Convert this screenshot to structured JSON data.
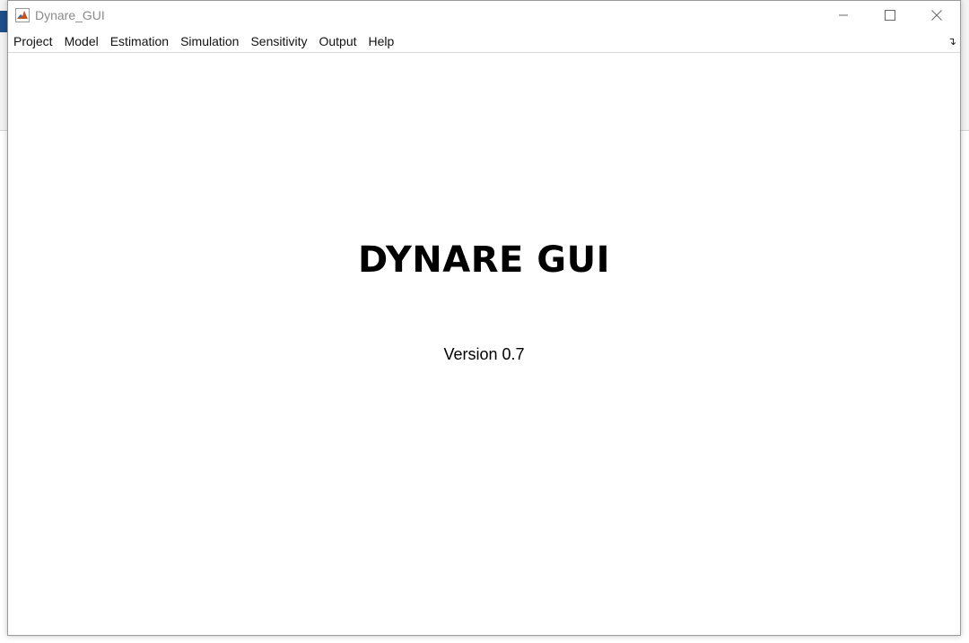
{
  "window": {
    "title": "Dynare_GUI",
    "icon": "matlab-icon"
  },
  "window_controls": {
    "minimize_icon": "minimize-icon",
    "maximize_icon": "maximize-icon",
    "close_icon": "close-icon"
  },
  "menubar": {
    "items": [
      {
        "label": "Project"
      },
      {
        "label": "Model"
      },
      {
        "label": "Estimation"
      },
      {
        "label": "Simulation"
      },
      {
        "label": "Sensitivity"
      },
      {
        "label": "Output"
      },
      {
        "label": "Help"
      }
    ],
    "dock_icon": "undock-arrow-icon"
  },
  "splash": {
    "title": "DYNARE GUI",
    "version": "Version 0.7"
  }
}
